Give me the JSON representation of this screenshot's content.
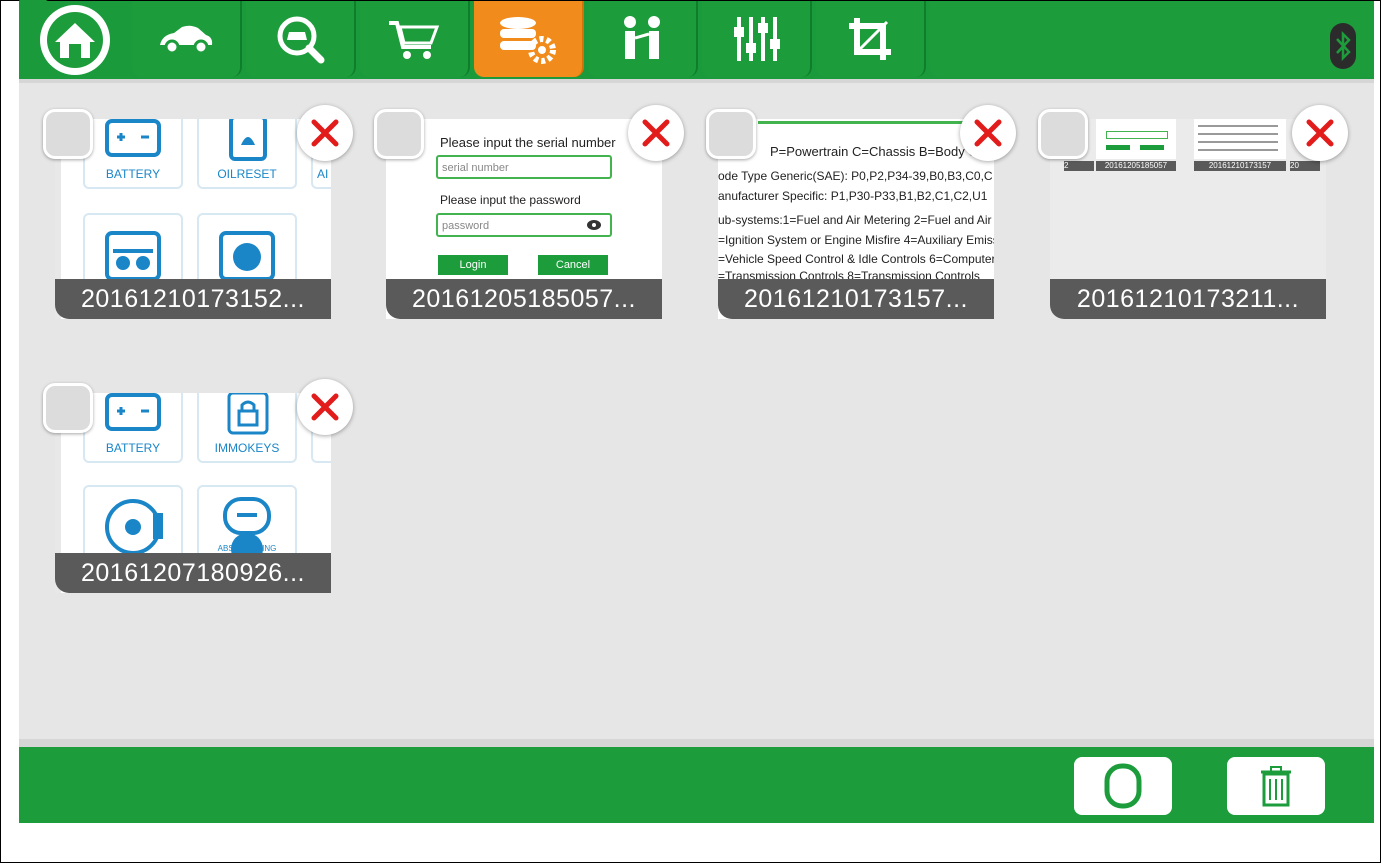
{
  "nav": {
    "tabs": [
      {
        "icon": "home-icon"
      },
      {
        "icon": "car-icon"
      },
      {
        "icon": "car-search-icon"
      },
      {
        "icon": "shopping-cart-icon"
      },
      {
        "icon": "database-settings-icon",
        "active": true
      },
      {
        "icon": "people-icon"
      },
      {
        "icon": "sliders-icon"
      },
      {
        "icon": "crop-icon"
      }
    ],
    "status_icon": "bluetooth-icon",
    "accent": "#1d9c3c",
    "active_color": "#f08b1c"
  },
  "gallery": {
    "items": [
      {
        "caption": "20161210173152...",
        "kind": "apps-a"
      },
      {
        "caption": "20161205185057...",
        "kind": "login"
      },
      {
        "caption": "20161210173157...",
        "kind": "dtc"
      },
      {
        "caption": "20161210173211...",
        "kind": "thumbs"
      },
      {
        "caption": "20161207180926...",
        "kind": "apps-b"
      }
    ]
  },
  "thumb_apps_a": {
    "tile1": "BATTERY",
    "tile2": "OILRESET",
    "tile3": "AI"
  },
  "thumb_apps_b": {
    "tile1": "BATTERY",
    "tile2": "IMMOKEYS",
    "tile3": "ABS BLEEDING"
  },
  "thumb_login": {
    "serial_label": "Please input the serial number",
    "serial_placeholder": "serial number",
    "password_label": "Please input the password",
    "password_placeholder": "password",
    "login": "Login",
    "cancel": "Cancel"
  },
  "thumb_dtc": {
    "l1": "P=Powertrain  C=Chassis  B=Body U",
    "l2": "ode Type Generic(SAE):  P0,P2,P34-39,B0,B3,C0,C",
    "l3": "anufacturer Specific:  P1,P30-P33,B1,B2,C1,C2,U1",
    "l4": "ub-systems:1=Fuel and Air Metering 2=Fuel and Air",
    "l5": "=Ignition System or Engine Misfire 4=Auxiliary Emiss",
    "l6": "=Vehicle Speed Control & Idle Controls 6=Computer",
    "l7": "=Transmission Controls 8=Transmission Controls"
  },
  "thumb_thumbs": {
    "c1": "20161205185057",
    "c2": "20161210173157",
    "c3": "2",
    "c4": "20"
  },
  "bottom": {
    "select_icon": "circle-select-icon",
    "delete_icon": "trash-icon"
  }
}
